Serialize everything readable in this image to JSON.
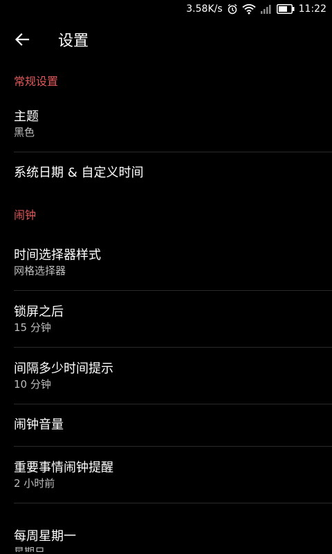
{
  "status_bar": {
    "speed": "3.58K/s",
    "time": "11:22",
    "icons": [
      "alarm-icon",
      "wifi-icon",
      "signal-icon",
      "battery-icon"
    ]
  },
  "app_bar": {
    "title": "设置",
    "back_icon": "back-arrow-icon"
  },
  "colors": {
    "background": "#000000",
    "accent": "#e0575a",
    "primary_text": "#ffffff",
    "secondary_text": "#bdbdbd",
    "divider": "#2a2a2a"
  },
  "sections": {
    "general": {
      "header": "常规设置",
      "theme": {
        "title": "主题",
        "summary": "黑色"
      },
      "datetime": {
        "title": "系统日期 & 自定义时间"
      }
    },
    "alarm": {
      "header": "闹钟",
      "picker_style": {
        "title": "时间选择器样式",
        "summary": "网格选择器"
      },
      "after_lock": {
        "title": "锁屏之后",
        "summary": "15 分钟"
      },
      "interval": {
        "title": "间隔多少时间提示",
        "summary": "10 分钟"
      },
      "volume": {
        "title": "闹钟音量"
      },
      "important": {
        "title": "重要事情闹钟提醒",
        "summary": "2 小时前"
      },
      "weekly": {
        "title": "每周星期一",
        "summary": "星期日"
      }
    }
  }
}
